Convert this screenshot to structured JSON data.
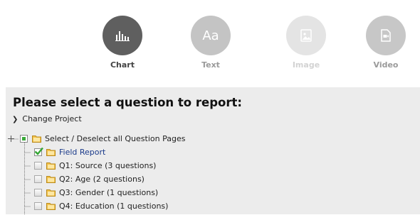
{
  "types": [
    {
      "key": "chart",
      "label": "Chart",
      "icon": "bar-chart-icon",
      "state": "active"
    },
    {
      "key": "text",
      "label": "Text",
      "icon": "text-aa-icon",
      "state": "enabled",
      "glyph": "Aa"
    },
    {
      "key": "image",
      "label": "Image",
      "icon": "image-icon",
      "state": "disabled"
    },
    {
      "key": "video",
      "label": "Video",
      "icon": "video-icon",
      "state": "enabled"
    }
  ],
  "panel": {
    "title": "Please select a question to report:",
    "change_project": "Change Project",
    "tree": {
      "root": {
        "label": "Select / Deselect all Question Pages",
        "state": "partial"
      },
      "items": [
        {
          "label": "Field Report",
          "state": "checked"
        },
        {
          "label": "Q1: Source (3 questions)",
          "state": "unchecked"
        },
        {
          "label": "Q2: Age (2 questions)",
          "state": "unchecked"
        },
        {
          "label": "Q3: Gender (1 questions)",
          "state": "unchecked"
        },
        {
          "label": "Q4: Education (1 questions)",
          "state": "unchecked"
        }
      ]
    }
  },
  "colors": {
    "active_circle": "#5f5f5f",
    "inactive_circle": "#c4c4c4",
    "disabled_circle": "#e4e4e4",
    "panel_bg": "#ececec",
    "check_green": "#3aa93a",
    "link_blue": "#1a3a8a"
  }
}
